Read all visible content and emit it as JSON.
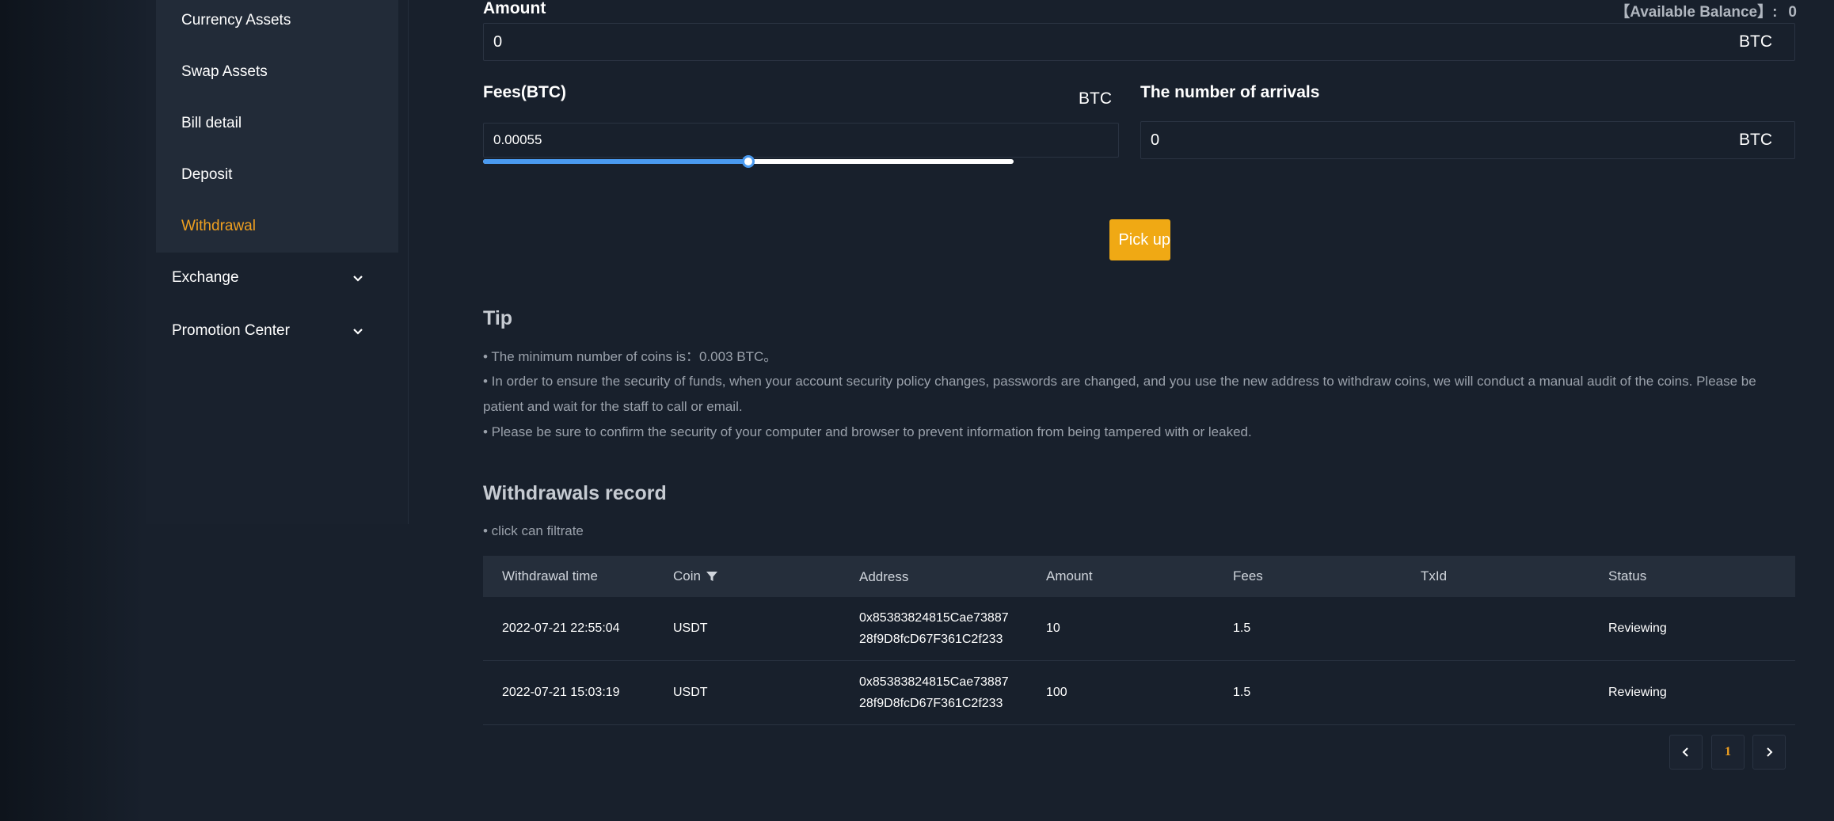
{
  "sidebar": {
    "submenu": [
      {
        "label": "Currency Assets"
      },
      {
        "label": "Swap Assets"
      },
      {
        "label": "Bill detail"
      },
      {
        "label": "Deposit"
      },
      {
        "label": "Withdrawal",
        "active": true
      }
    ],
    "groups": [
      {
        "label": "Exchange",
        "icon": "chevron-down-icon"
      },
      {
        "label": "Promotion Center",
        "icon": "chevron-down-icon"
      }
    ]
  },
  "form": {
    "amount_label": "Amount",
    "balance_label": "【Available Balance】:",
    "balance_value": "0",
    "amount_value": "0",
    "amount_unit": "BTC",
    "fees_label": "Fees(BTC)",
    "fees_unit": "BTC",
    "fees_value": "0.00055",
    "fees_slider_fraction": 0.5,
    "arrivals_label": "The number of arrivals",
    "arrivals_value": "0",
    "arrivals_unit": "BTC",
    "submit_label": "Pick up"
  },
  "tip": {
    "title": "Tip",
    "lines": [
      "• The minimum number of coins is：0.003 BTC。",
      "• In order to ensure the security of funds, when your account security policy changes, passwords are changed, and you use the new address to withdraw coins, we will conduct a manual audit of the coins. Please be patient and wait for the staff to call or email.",
      "• Please be sure to confirm the security of your computer and browser to prevent information from being tampered with or leaked."
    ]
  },
  "records": {
    "title": "Withdrawals record",
    "hint": "• click can filtrate",
    "columns": [
      "Withdrawal time",
      "Coin",
      "Address",
      "Amount",
      "Fees",
      "TxId",
      "Status"
    ],
    "rows": [
      {
        "time": "2022-07-21 22:55:04",
        "coin": "USDT",
        "address": "0x85383824815Cae7388728f9D8fcD67F361C2f233",
        "amount": "10",
        "fees": "1.5",
        "txid": "",
        "status": "Reviewing"
      },
      {
        "time": "2022-07-21 15:03:19",
        "coin": "USDT",
        "address": "0x85383824815Cae7388728f9D8fcD67F361C2f233",
        "amount": "100",
        "fees": "1.5",
        "txid": "",
        "status": "Reviewing"
      }
    ],
    "pagination": {
      "current": "1"
    }
  },
  "colors": {
    "accent": "#f0a914",
    "active_menu": "#f0a020",
    "slider": "#4a9af0",
    "background": "#18202c"
  }
}
